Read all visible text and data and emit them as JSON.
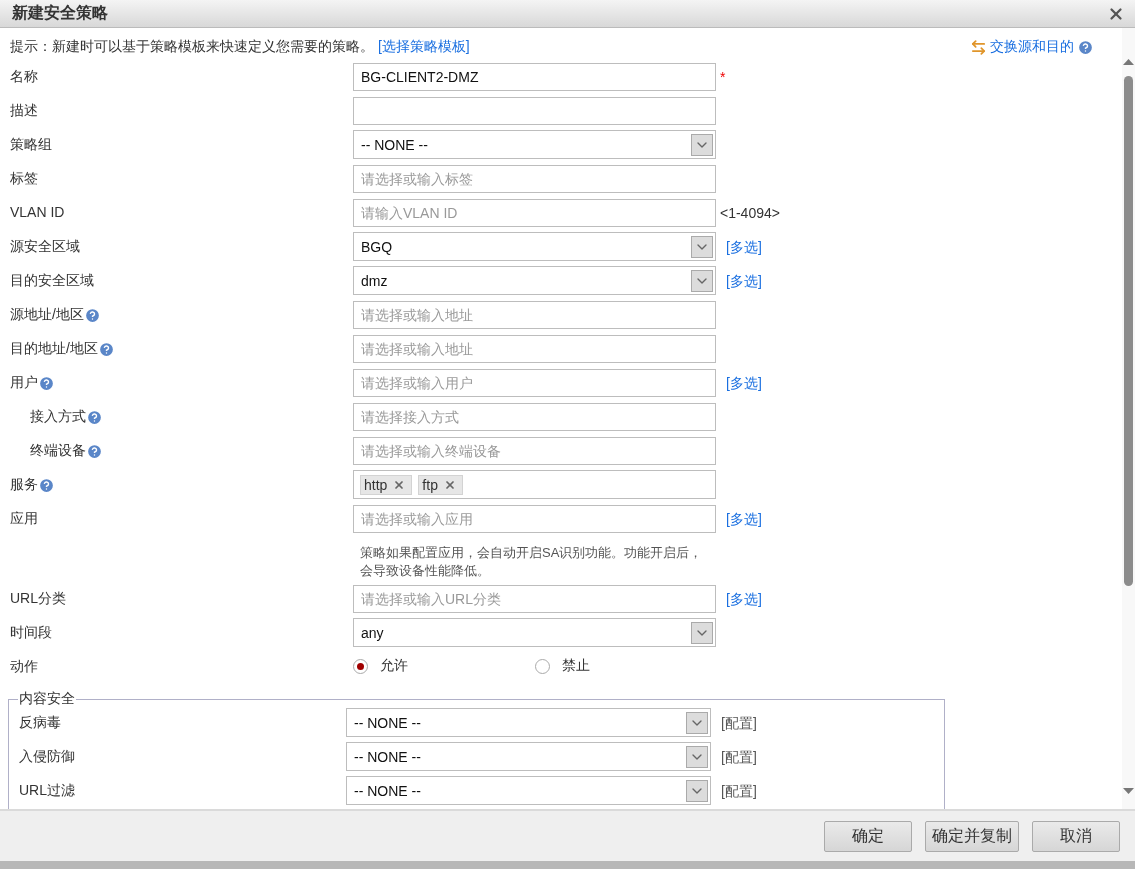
{
  "window": {
    "title": "新建安全策略"
  },
  "hint": {
    "text": "提示：新建时可以基于策略模板来快速定义您需要的策略。",
    "link": "[选择策略模板]"
  },
  "swap_link": {
    "label": "交换源和目的",
    "help": true
  },
  "fields": [
    {
      "kind": "text",
      "label": "名称",
      "help": false,
      "required_mark": "*",
      "value": "BG-CLIENT2-DMZ"
    },
    {
      "kind": "text",
      "label": "描述",
      "help": false
    },
    {
      "kind": "select",
      "label": "策略组",
      "help": false,
      "value": "-- NONE --"
    },
    {
      "kind": "text",
      "label": "标签",
      "help": false,
      "placeholder": "请选择或输入标签"
    },
    {
      "kind": "text",
      "label": "VLAN ID",
      "help": false,
      "placeholder": "请输入VLAN ID",
      "suffix": "<1-4094>"
    },
    {
      "kind": "select",
      "label": "源安全区域",
      "help": false,
      "value": "BGQ",
      "multi": "[多选]"
    },
    {
      "kind": "select",
      "label": "目的安全区域",
      "help": false,
      "value": "dmz",
      "multi": "[多选]"
    },
    {
      "kind": "text",
      "label": "源地址/地区",
      "help": true,
      "placeholder": "请选择或输入地址"
    },
    {
      "kind": "text",
      "label": "目的地址/地区",
      "help": true,
      "placeholder": "请选择或输入地址"
    },
    {
      "kind": "text",
      "label": "用户",
      "help": true,
      "placeholder": "请选择或输入用户",
      "multi": "[多选]",
      "children": [
        {
          "kind": "text",
          "label": "接入方式",
          "help": true,
          "placeholder": "请选择接入方式"
        },
        {
          "kind": "text",
          "label": "终端设备",
          "help": true,
          "placeholder": "请选择或输入终端设备"
        }
      ]
    },
    {
      "kind": "tags",
      "label": "服务",
      "help": true,
      "tags": [
        "http",
        "ftp"
      ]
    },
    {
      "kind": "text",
      "label": "应用",
      "help": false,
      "placeholder": "请选择或输入应用",
      "multi": "[多选]",
      "note": "策略如果配置应用，会自动开启SA识别功能。功能开启后，会导致设备性能降低。"
    },
    {
      "kind": "text",
      "label": "URL分类",
      "help": false,
      "placeholder": "请选择或输入URL分类",
      "multi": "[多选]"
    },
    {
      "kind": "select",
      "label": "时间段",
      "help": false,
      "value": "any"
    },
    {
      "kind": "radio",
      "label": "动作",
      "help": false,
      "options": [
        {
          "label": "允许",
          "selected": true
        },
        {
          "label": "禁止",
          "selected": false
        }
      ]
    }
  ],
  "content_security": {
    "legend": "内容安全",
    "rows": [
      {
        "label": "反病毒",
        "value": "-- NONE --",
        "link": "[配置]"
      },
      {
        "label": "入侵防御",
        "value": "-- NONE --",
        "link": "[配置]"
      },
      {
        "label": "URL过滤",
        "value": "-- NONE --",
        "link": "[配置]"
      }
    ]
  },
  "buttons": [
    "确定",
    "确定并复制",
    "取消"
  ]
}
